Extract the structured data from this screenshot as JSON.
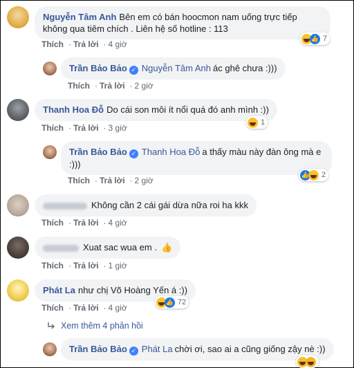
{
  "actions": {
    "like": "Thích",
    "reply": "Trả lời",
    "see_more_replies": "Xem thêm 4 phản hồi"
  },
  "comments": [
    {
      "author": "Nguyễn Tâm Anh",
      "text": "Bên em có bán hoocmon nam uống trực tiếp không qua tiêm chích . Liên hệ số hotline : 113",
      "time": "4 giờ",
      "reactions": "7"
    },
    {
      "author": "Trần Bảo Bảo",
      "mention": "Nguyễn Tâm Anh",
      "text": "ác ghê chưa :)))",
      "time": "2 giờ"
    },
    {
      "author": "Thanh Hoa Đỗ",
      "text": "Do cái son môi ít nổi quá đó anh mình :))",
      "time": "3 giờ",
      "reactions": "1"
    },
    {
      "author": "Trần Bảo Bảo",
      "mention": "Thanh Hoa Đỗ",
      "text": "a thấy màu này đàn ông mà e :)))",
      "time": "2 giờ",
      "reactions": "2"
    },
    {
      "author": "",
      "text": "Không cần 2 cái gái dừa nữa roi ha kkk",
      "time": "4 giờ"
    },
    {
      "author": "",
      "text": "Xuat sac wua em .",
      "time": "1 giờ"
    },
    {
      "author": "Phát La",
      "text": "như chị Võ Hoàng Yến á :))",
      "time": "4 giờ",
      "reactions": "72"
    },
    {
      "author": "Trần Bảo Bảo",
      "mention": "Phát La",
      "text": "chời ơi, sao ai a cũng giống zậy nè :))"
    }
  ],
  "colors": {
    "link": "#385898",
    "bubble": "#f2f3f5",
    "meta": "#606770"
  }
}
